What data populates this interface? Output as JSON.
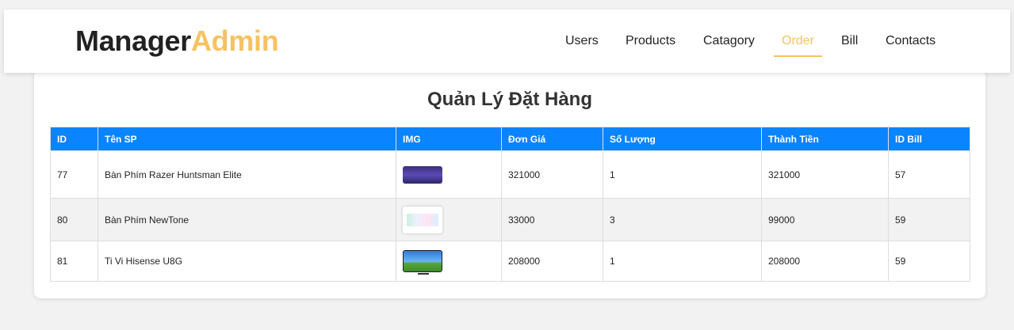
{
  "brand": {
    "part1": "Manager",
    "part2": "Admin"
  },
  "nav": [
    {
      "label": "Users"
    },
    {
      "label": "Products"
    },
    {
      "label": "Catagory"
    },
    {
      "label": "Order"
    },
    {
      "label": "Bill"
    },
    {
      "label": "Contacts"
    }
  ],
  "nav_active": "Order",
  "page": {
    "title": "Quản Lý Đặt Hàng"
  },
  "table": {
    "headers": [
      "ID",
      "Tên SP",
      "IMG",
      "Đơn Giá",
      "Số Lượng",
      "Thành Tiền",
      "ID Bill"
    ],
    "rows": [
      {
        "id": "77",
        "name": "Bàn Phím Razer Huntsman Elite",
        "img": "keyboard-purple",
        "price": "321000",
        "qty": "1",
        "total": "321000",
        "bill": "57"
      },
      {
        "id": "80",
        "name": "Bàn Phím NewTone",
        "img": "keyboard-pastel",
        "price": "33000",
        "qty": "3",
        "total": "99000",
        "bill": "59"
      },
      {
        "id": "81",
        "name": "Ti Vi Hisense U8G",
        "img": "tv-landscape",
        "price": "208000",
        "qty": "1",
        "total": "208000",
        "bill": "59"
      }
    ]
  },
  "colors": {
    "accent": "#f6c261",
    "header_bg": "#0a84ff",
    "text": "#222222"
  }
}
